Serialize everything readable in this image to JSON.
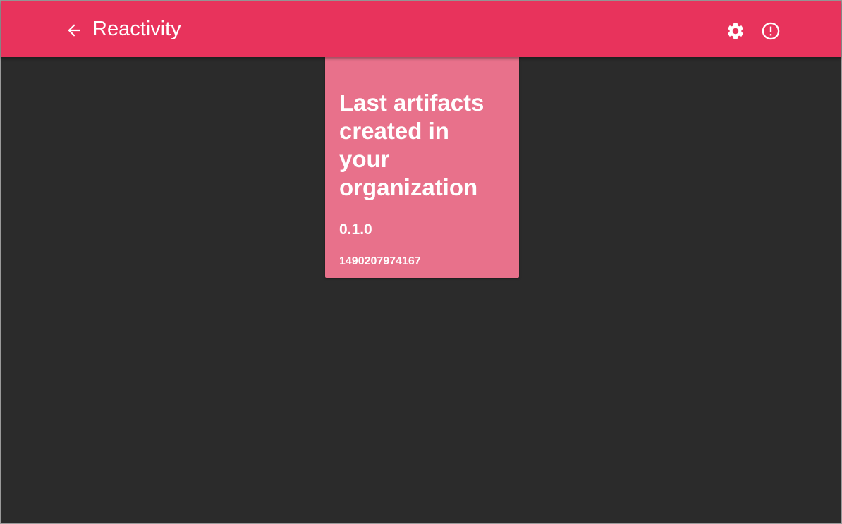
{
  "app_bar": {
    "title": "Reactivity",
    "back_icon": "arrow-left-icon",
    "settings_icon": "gear-icon",
    "info_icon": "alert-circle-icon",
    "background_color": "#e8335c"
  },
  "card": {
    "title": "Last artifacts created in your organization",
    "version": "0.1.0",
    "id": "1490207974167",
    "background_color": "#e8718b"
  },
  "page": {
    "background_color": "#2b2b2b"
  }
}
